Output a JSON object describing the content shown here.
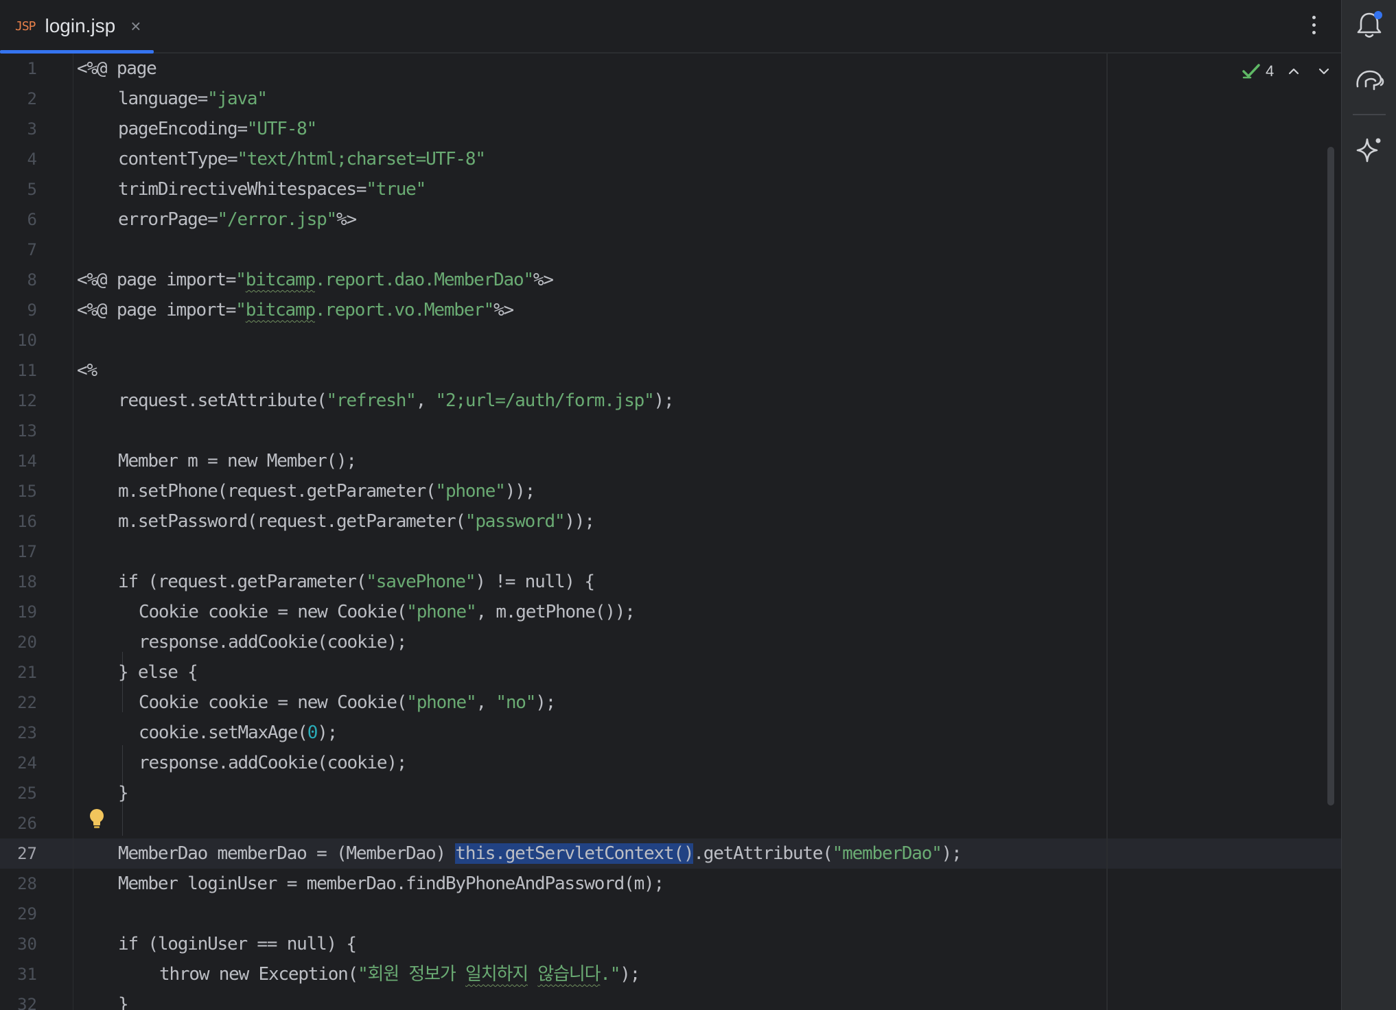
{
  "tab": {
    "icon_label": "JSP",
    "title": "login.jsp",
    "close_glyph": "×"
  },
  "inspections": {
    "count": "4"
  },
  "accent_color": "#3574f0",
  "icons": {
    "notifications": "bell-icon",
    "database": "elephant-icon",
    "ai_assistant": "sparkle-icon"
  },
  "editor": {
    "current_line": 27,
    "lines": [
      {
        "n": "1",
        "indent": 0,
        "segs": [
          {
            "t": "<%@ page"
          }
        ]
      },
      {
        "n": "2",
        "indent": 2,
        "segs": [
          {
            "t": "language="
          },
          {
            "t": "\"java\"",
            "c": "str"
          }
        ]
      },
      {
        "n": "3",
        "indent": 2,
        "segs": [
          {
            "t": "pageEncoding="
          },
          {
            "t": "\"UTF-8\"",
            "c": "str"
          }
        ]
      },
      {
        "n": "4",
        "indent": 2,
        "segs": [
          {
            "t": "contentType="
          },
          {
            "t": "\"text/html;charset=UTF-8\"",
            "c": "str"
          }
        ]
      },
      {
        "n": "5",
        "indent": 2,
        "segs": [
          {
            "t": "trimDirectiveWhitespaces="
          },
          {
            "t": "\"true\"",
            "c": "str"
          }
        ]
      },
      {
        "n": "6",
        "indent": 2,
        "segs": [
          {
            "t": "errorPage="
          },
          {
            "t": "\"/error.jsp\"",
            "c": "str"
          },
          {
            "t": "%>"
          }
        ]
      },
      {
        "n": "7",
        "indent": 0,
        "segs": []
      },
      {
        "n": "8",
        "indent": 0,
        "segs": [
          {
            "t": "<%@ page import="
          },
          {
            "t": "\"",
            "c": "str"
          },
          {
            "t": "bitcamp",
            "c": "str wavy"
          },
          {
            "t": ".report.dao.MemberDao\"",
            "c": "str"
          },
          {
            "t": "%>"
          }
        ]
      },
      {
        "n": "9",
        "indent": 0,
        "segs": [
          {
            "t": "<%@ page import="
          },
          {
            "t": "\"",
            "c": "str"
          },
          {
            "t": "bitcamp",
            "c": "str wavy"
          },
          {
            "t": ".report.vo.Member\"",
            "c": "str"
          },
          {
            "t": "%>"
          }
        ]
      },
      {
        "n": "10",
        "indent": 0,
        "segs": []
      },
      {
        "n": "11",
        "indent": 0,
        "segs": [
          {
            "t": "<%"
          }
        ]
      },
      {
        "n": "12",
        "indent": 2,
        "segs": [
          {
            "t": "request.setAttribute("
          },
          {
            "t": "\"refresh\"",
            "c": "str"
          },
          {
            "t": ", "
          },
          {
            "t": "\"2;url=/auth/form.jsp\"",
            "c": "str"
          },
          {
            "t": ");"
          }
        ]
      },
      {
        "n": "13",
        "indent": 0,
        "segs": []
      },
      {
        "n": "14",
        "indent": 2,
        "segs": [
          {
            "t": "Member m = new Member();"
          }
        ]
      },
      {
        "n": "15",
        "indent": 2,
        "segs": [
          {
            "t": "m.setPhone(request.getParameter("
          },
          {
            "t": "\"phone\"",
            "c": "str"
          },
          {
            "t": "));"
          }
        ]
      },
      {
        "n": "16",
        "indent": 2,
        "segs": [
          {
            "t": "m.setPassword(request.getParameter("
          },
          {
            "t": "\"password\"",
            "c": "str"
          },
          {
            "t": "));"
          }
        ]
      },
      {
        "n": "17",
        "indent": 0,
        "segs": []
      },
      {
        "n": "18",
        "indent": 2,
        "segs": [
          {
            "t": "if (request.getParameter("
          },
          {
            "t": "\"savePhone\"",
            "c": "str"
          },
          {
            "t": ") != null) {"
          }
        ]
      },
      {
        "n": "19",
        "indent": 3,
        "segs": [
          {
            "t": "Cookie cookie = new Cookie("
          },
          {
            "t": "\"phone\"",
            "c": "str"
          },
          {
            "t": ", m.getPhone());"
          }
        ]
      },
      {
        "n": "20",
        "indent": 3,
        "segs": [
          {
            "t": "response.addCookie(cookie);"
          }
        ]
      },
      {
        "n": "21",
        "indent": 2,
        "segs": [
          {
            "t": "} else {"
          }
        ]
      },
      {
        "n": "22",
        "indent": 3,
        "segs": [
          {
            "t": "Cookie cookie = new Cookie("
          },
          {
            "t": "\"phone\"",
            "c": "str"
          },
          {
            "t": ", "
          },
          {
            "t": "\"no\"",
            "c": "str"
          },
          {
            "t": ");"
          }
        ]
      },
      {
        "n": "23",
        "indent": 3,
        "segs": [
          {
            "t": "cookie.setMaxAge("
          },
          {
            "t": "0",
            "c": "num"
          },
          {
            "t": ");"
          }
        ]
      },
      {
        "n": "24",
        "indent": 3,
        "segs": [
          {
            "t": "response.addCookie(cookie);"
          }
        ]
      },
      {
        "n": "25",
        "indent": 2,
        "segs": [
          {
            "t": "}"
          }
        ]
      },
      {
        "n": "26",
        "indent": 0,
        "segs": []
      },
      {
        "n": "27",
        "indent": 2,
        "segs": [
          {
            "t": "MemberDao memberDao = (MemberDao) "
          },
          {
            "t": "this.getServletContext()",
            "c": "sel"
          },
          {
            "t": ".getAttribute("
          },
          {
            "t": "\"memberDao\"",
            "c": "str"
          },
          {
            "t": ");"
          }
        ]
      },
      {
        "n": "28",
        "indent": 2,
        "segs": [
          {
            "t": "Member loginUser = memberDao.findByPhoneAndPassword(m);"
          }
        ]
      },
      {
        "n": "29",
        "indent": 0,
        "segs": []
      },
      {
        "n": "30",
        "indent": 2,
        "segs": [
          {
            "t": "if (loginUser == null) {"
          }
        ]
      },
      {
        "n": "31",
        "indent": 4,
        "segs": [
          {
            "t": "throw new Exception("
          },
          {
            "t": "\"회원 정보가 ",
            "c": "str"
          },
          {
            "t": "일치하지",
            "c": "str wavy"
          },
          {
            "t": " ",
            "c": "str"
          },
          {
            "t": "않습니다",
            "c": "str wavy"
          },
          {
            "t": ".\"",
            "c": "str"
          },
          {
            "t": ");"
          }
        ]
      },
      {
        "n": "32",
        "indent": 2,
        "segs": [
          {
            "t": "}"
          }
        ]
      }
    ]
  }
}
